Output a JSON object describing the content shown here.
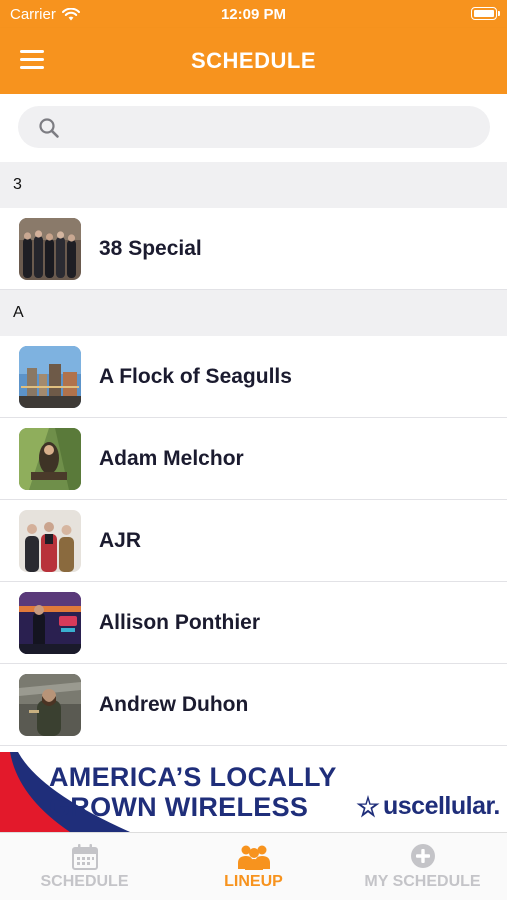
{
  "status_bar": {
    "carrier": "Carrier",
    "time": "12:09 PM"
  },
  "nav": {
    "title": "SCHEDULE"
  },
  "search": {
    "placeholder": "",
    "value": ""
  },
  "sections": [
    {
      "header": "3",
      "items": [
        {
          "name": "38 Special"
        }
      ]
    },
    {
      "header": "A",
      "items": [
        {
          "name": "A Flock of Seagulls"
        },
        {
          "name": "Adam Melchor"
        },
        {
          "name": "AJR"
        },
        {
          "name": "Allison Ponthier"
        },
        {
          "name": "Andrew Duhon"
        }
      ]
    }
  ],
  "banner": {
    "line1": "AMERICA’S LOCALLY",
    "line2": "GROWN WIRELESS",
    "brand": "uscellular."
  },
  "tabs": [
    {
      "label": "SCHEDULE",
      "icon": "calendar-icon",
      "active": false
    },
    {
      "label": "LINEUP",
      "icon": "group-icon",
      "active": true
    },
    {
      "label": "MY SCHEDULE",
      "icon": "plus-circle-icon",
      "active": false
    }
  ],
  "colors": {
    "accent": "#f7931e",
    "inactive": "#c4c4c8",
    "banner_blue": "#1f2e7a",
    "banner_red": "#e3192b"
  }
}
